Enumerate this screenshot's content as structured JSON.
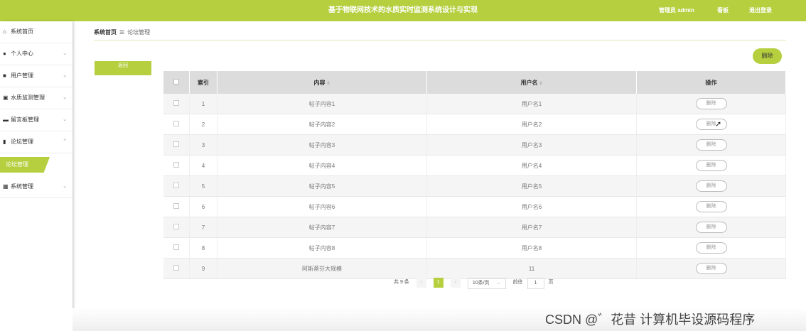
{
  "header": {
    "title": "基于物联网技术的水质实时监测系统设计与实现",
    "user_label": "管理员 admin",
    "board_label": "看板",
    "logout_label": "退出登录"
  },
  "sidebar": {
    "items": [
      {
        "label": "系统首页",
        "icon": "home-icon",
        "glyph": "⌂"
      },
      {
        "label": "个人中心",
        "icon": "user-icon",
        "glyph": "●",
        "chev": "⌄"
      },
      {
        "label": "用户管理",
        "icon": "users-icon",
        "glyph": "■",
        "chev": "⌄"
      },
      {
        "label": "水质监测管理",
        "icon": "chart-icon",
        "glyph": "▣",
        "chev": "⌄"
      },
      {
        "label": "留言板管理",
        "icon": "comment-icon",
        "glyph": "▬",
        "chev": "⌄"
      },
      {
        "label": "论坛管理",
        "icon": "bar-icon",
        "glyph": "▮",
        "chev": "⌃"
      }
    ],
    "sub_item": "论坛管理",
    "last_item": {
      "label": "系统管理",
      "icon": "grid-icon",
      "glyph": "▦",
      "chev": "⌄"
    }
  },
  "breadcrumb": {
    "home": "系统首页",
    "sep": "☰",
    "current": "论坛管理"
  },
  "buttons": {
    "back": "返回",
    "delete": "删除"
  },
  "table": {
    "headers": [
      "索引",
      "内容",
      "用户名",
      "操作"
    ],
    "rows": [
      {
        "index": "1",
        "content": "帖子内容1",
        "username": "用户名1",
        "action": "删除"
      },
      {
        "index": "2",
        "content": "帖子内容2",
        "username": "用户名2",
        "action": "删除"
      },
      {
        "index": "3",
        "content": "帖子内容3",
        "username": "用户名3",
        "action": "删除"
      },
      {
        "index": "4",
        "content": "帖子内容4",
        "username": "用户名4",
        "action": "删除"
      },
      {
        "index": "5",
        "content": "帖子内容5",
        "username": "用户名5",
        "action": "删除"
      },
      {
        "index": "6",
        "content": "帖子内容6",
        "username": "用户名6",
        "action": "删除"
      },
      {
        "index": "7",
        "content": "帖子内容7",
        "username": "用户名7",
        "action": "删除"
      },
      {
        "index": "8",
        "content": "帖子内容8",
        "username": "用户名8",
        "action": "删除"
      },
      {
        "index": "9",
        "content": "阿斯蒂芬大规模",
        "username": "11",
        "action": "删除"
      }
    ]
  },
  "pagination": {
    "total": "共 9 条",
    "prev": "‹",
    "current": "1",
    "next": "›",
    "page_size": "10条/页",
    "goto_label": "前往",
    "goto_value": "1",
    "page_unit": "页"
  },
  "watermark": "CSDN @゛花昔 计算机毕设源码程序",
  "colors": {
    "accent": "#b5cf3f"
  }
}
